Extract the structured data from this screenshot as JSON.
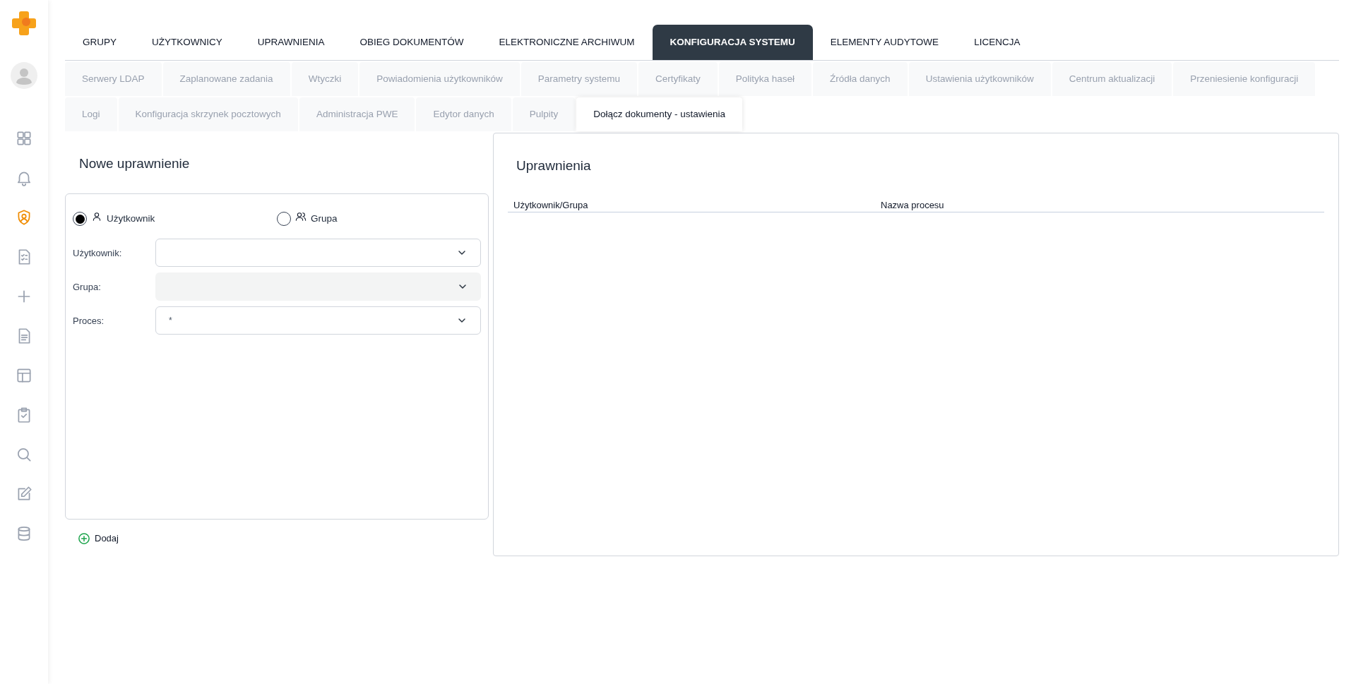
{
  "sidebar": {
    "items": [
      {
        "kind": "grid",
        "selected": false
      },
      {
        "kind": "bell",
        "selected": false
      },
      {
        "kind": "shield",
        "selected": true
      },
      {
        "kind": "checklist",
        "selected": false
      },
      {
        "kind": "plus",
        "selected": false
      },
      {
        "kind": "document",
        "selected": false
      },
      {
        "kind": "layout",
        "selected": false
      },
      {
        "kind": "clipboard",
        "selected": false
      },
      {
        "kind": "search",
        "selected": false
      },
      {
        "kind": "edit",
        "selected": false
      },
      {
        "kind": "database",
        "selected": false
      }
    ]
  },
  "main_tabs": [
    {
      "label": "GRUPY",
      "selected": false
    },
    {
      "label": "UŻYTKOWNICY",
      "selected": false
    },
    {
      "label": "UPRAWNIENIA",
      "selected": false
    },
    {
      "label": "OBIEG DOKUMENTÓW",
      "selected": false
    },
    {
      "label": "ELEKTRONICZNE ARCHIWUM",
      "selected": false
    },
    {
      "label": "KONFIGURACJA SYSTEMU",
      "selected": true
    },
    {
      "label": "ELEMENTY AUDYTOWE",
      "selected": false
    },
    {
      "label": "LICENCJA",
      "selected": false
    }
  ],
  "sub_tabs": [
    [
      {
        "label": "Serwery LDAP",
        "selected": false
      },
      {
        "label": "Zaplanowane zadania",
        "selected": false
      },
      {
        "label": "Wtyczki",
        "selected": false
      },
      {
        "label": "Powiadomienia użytkowników",
        "selected": false
      },
      {
        "label": "Parametry systemu",
        "selected": false
      },
      {
        "label": "Certyfikaty",
        "selected": false
      },
      {
        "label": "Polityka haseł",
        "selected": false
      },
      {
        "label": "Źródła danych",
        "selected": false
      },
      {
        "label": "Ustawienia użytkowników",
        "selected": false
      },
      {
        "label": "Centrum aktualizacji",
        "selected": false
      },
      {
        "label": "Przeniesienie konfiguracji",
        "selected": false
      }
    ],
    [
      {
        "label": "Logi",
        "selected": false
      },
      {
        "label": "Konfiguracja skrzynek pocztowych",
        "selected": false
      },
      {
        "label": "Administracja PWE",
        "selected": false
      },
      {
        "label": "Edytor danych",
        "selected": false
      },
      {
        "label": "Pulpity",
        "selected": false
      },
      {
        "label": "Dołącz dokumenty - ustawienia",
        "selected": true
      }
    ]
  ],
  "new_permission": {
    "title": "Nowe uprawnienie",
    "radios": [
      {
        "kind": "user",
        "label": "Użytkownik",
        "selected": true
      },
      {
        "kind": "group",
        "label": "Grupa",
        "selected": false
      }
    ],
    "fields": [
      {
        "label": "Użytkownik:",
        "disabled": false
      },
      {
        "label": "Grupa:",
        "disabled": true
      },
      {
        "label": "Proces:",
        "value": "*",
        "disabled": false
      }
    ],
    "add_button": "Dodaj"
  },
  "permissions": {
    "title": "Uprawnienia",
    "columns": [
      "Użytkownik/Grupa",
      "Nazwa procesu"
    ]
  }
}
